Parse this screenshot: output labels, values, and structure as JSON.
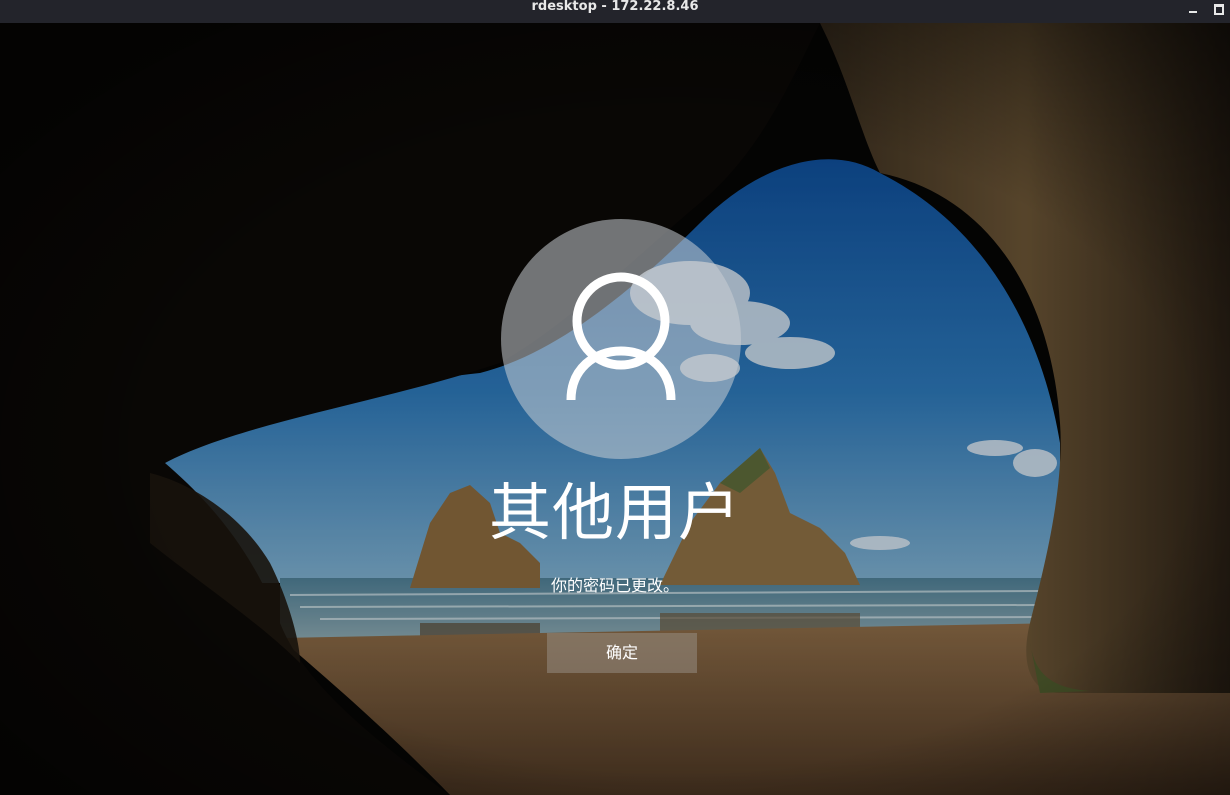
{
  "window": {
    "title": "rdesktop - 172.22.8.46",
    "minimize_icon": "minimize-icon",
    "maximize_icon": "maximize-icon"
  },
  "lock_screen": {
    "avatar_icon": "user-icon",
    "username": "其他用户",
    "message": "你的密码已更改。",
    "ok_label": "确定"
  },
  "colors": {
    "titlebar": "#23242b",
    "sky": "#2f6fb0",
    "sand": "#7a5a3a",
    "rock": "#1a1410"
  }
}
